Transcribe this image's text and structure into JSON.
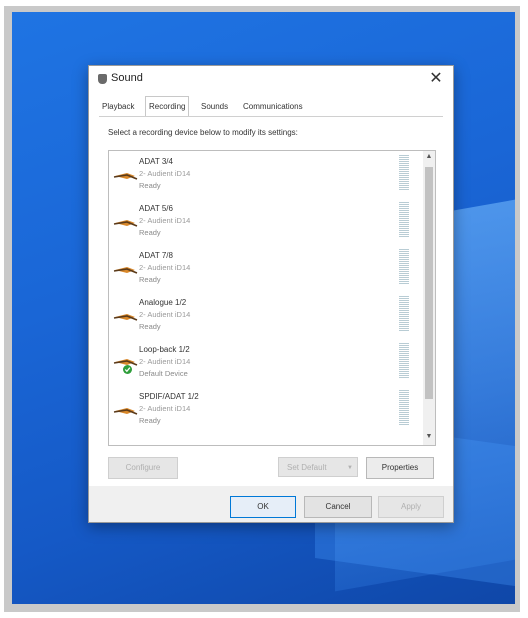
{
  "window": {
    "title": "Sound",
    "close_glyph": "✕"
  },
  "tabs": [
    {
      "label": "Playback"
    },
    {
      "label": "Recording"
    },
    {
      "label": "Sounds"
    },
    {
      "label": "Communications"
    }
  ],
  "active_tab": "Recording",
  "instruction": "Select a recording device below to modify its settings:",
  "devices": [
    {
      "name": "ADAT 3/4",
      "sub": "2- Audient iD14",
      "status": "Ready",
      "default": false
    },
    {
      "name": "ADAT 5/6",
      "sub": "2- Audient iD14",
      "status": "Ready",
      "default": false
    },
    {
      "name": "ADAT 7/8",
      "sub": "2- Audient iD14",
      "status": "Ready",
      "default": false
    },
    {
      "name": "Analogue 1/2",
      "sub": "2- Audient iD14",
      "status": "Ready",
      "default": false
    },
    {
      "name": "Loop-back 1/2",
      "sub": "2- Audient iD14",
      "status": "Default Device",
      "default": true
    },
    {
      "name": "SPDIF/ADAT 1/2",
      "sub": "2- Audient iD14",
      "status": "Ready",
      "default": false
    }
  ],
  "buttons": {
    "configure": "Configure",
    "set_default": "Set Default",
    "set_default_arrow": "▼",
    "properties": "Properties",
    "ok": "OK",
    "cancel": "Cancel",
    "apply": "Apply"
  },
  "scroll": {
    "up": "▲",
    "down": "▼"
  },
  "icons": {
    "window": "speaker-icon",
    "device": "microphone-jack-icon",
    "default": "green-check-icon"
  },
  "colors": {
    "desktop": "#1a66d6",
    "jack_orange": "#d9882a",
    "check_green": "#2e9e3a"
  }
}
